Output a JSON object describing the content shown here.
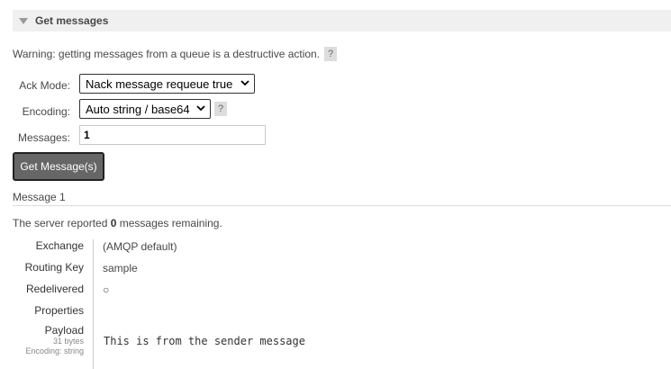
{
  "section": {
    "title": "Get messages"
  },
  "warning": {
    "text": "Warning: getting messages from a queue is a destructive action.",
    "help": "?"
  },
  "form": {
    "ack_mode_label": "Ack Mode:",
    "ack_mode_value": "Nack message requeue true",
    "encoding_label": "Encoding:",
    "encoding_value": "Auto string / base64",
    "encoding_help": "?",
    "messages_label": "Messages:",
    "messages_value": "1",
    "submit_label": "Get Message(s)"
  },
  "result": {
    "title": "Message 1",
    "remaining_prefix": "The server reported ",
    "remaining_count": "0",
    "remaining_suffix": " messages remaining.",
    "fields": {
      "exchange_label": "Exchange",
      "exchange_value": "(AMQP default)",
      "routing_key_label": "Routing Key",
      "routing_key_value": "sample",
      "redelivered_label": "Redelivered",
      "redelivered_value": "○",
      "properties_label": "Properties",
      "payload_label": "Payload",
      "payload_size": "31 bytes",
      "payload_encoding": "Encoding: string",
      "payload_value": "This is from the sender message"
    }
  },
  "icons": {
    "collapse": "triangle-down-icon",
    "select_chevron": "chevron-down-icon"
  }
}
